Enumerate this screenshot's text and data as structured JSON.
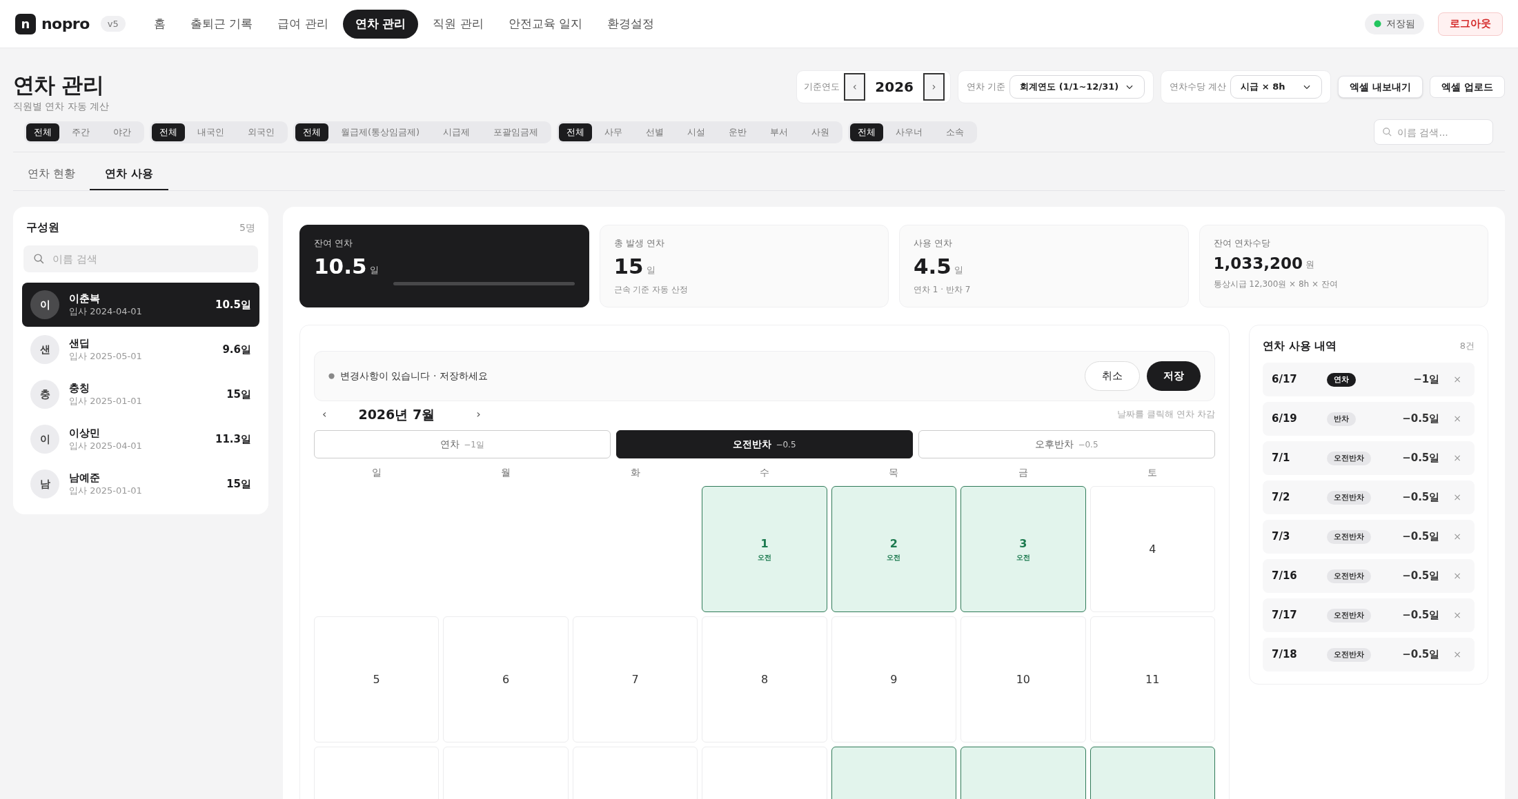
{
  "nav": {
    "logo_letter": "n",
    "brand": "nopro",
    "version": "v5",
    "items": [
      {
        "label": "홈",
        "selected": false
      },
      {
        "label": "출퇴근 기록",
        "selected": false
      },
      {
        "label": "급여 관리",
        "selected": false
      },
      {
        "label": "연차 관리",
        "selected": true
      },
      {
        "label": "직원 관리",
        "selected": false
      },
      {
        "label": "안전교육 일지",
        "selected": false
      },
      {
        "label": "환경설정",
        "selected": false
      }
    ],
    "status": "저장됨",
    "logout": "로그아웃"
  },
  "header": {
    "title": "연차 관리",
    "subtitle": "직원별 연차 자동 계산",
    "year": {
      "label": "기준연도",
      "prev": "‹",
      "value": "2026",
      "next": "›"
    },
    "basis": {
      "label": "연차 기준",
      "value": "회계연도 (1/1~12/31)"
    },
    "allowance": {
      "label": "연차수당 계산",
      "value": "시급 × 8h"
    },
    "buttons": [
      "엑셀 내보내기",
      "엑셀 업로드"
    ]
  },
  "filter_groups": [
    [
      {
        "label": "전체",
        "selected": true
      },
      {
        "label": "주간",
        "selected": false
      },
      {
        "label": "야간",
        "selected": false
      }
    ],
    [
      {
        "label": "전체",
        "selected": true
      },
      {
        "label": "내국인",
        "selected": false
      },
      {
        "label": "외국인",
        "selected": false
      }
    ],
    [
      {
        "label": "전체",
        "selected": true
      },
      {
        "label": "월급제(통상임금제)",
        "selected": false
      },
      {
        "label": "시급제",
        "selected": false
      },
      {
        "label": "포괄임금제",
        "selected": false
      }
    ],
    [
      {
        "label": "전체",
        "selected": true
      },
      {
        "label": "사무",
        "selected": false
      },
      {
        "label": "선별",
        "selected": false
      },
      {
        "label": "시설",
        "selected": false
      },
      {
        "label": "운반",
        "selected": false
      },
      {
        "label": "부서",
        "selected": false
      },
      {
        "label": "사원",
        "selected": false
      }
    ],
    [
      {
        "label": "전체",
        "selected": true
      },
      {
        "label": "사우너",
        "selected": false
      },
      {
        "label": "소속",
        "selected": false
      }
    ]
  ],
  "search": {
    "placeholder": "이름 검색..."
  },
  "tabs": [
    {
      "label": "연차 현황",
      "selected": false
    },
    {
      "label": "연차 사용",
      "selected": true
    }
  ],
  "members": {
    "title": "구성원",
    "count": "5명",
    "search_placeholder": "이름 검색",
    "items": [
      {
        "avatar": "이",
        "name": "이춘복",
        "joined": "입사 2024-04-01",
        "balance": "10.5일",
        "selected": true
      },
      {
        "avatar": "샌",
        "name": "샌딥",
        "joined": "입사 2025-05-01",
        "balance": "9.6일",
        "selected": false
      },
      {
        "avatar": "충",
        "name": "충칭",
        "joined": "입사 2025-01-01",
        "balance": "15일",
        "selected": false
      },
      {
        "avatar": "이",
        "name": "이상민",
        "joined": "입사 2025-04-01",
        "balance": "11.3일",
        "selected": false
      },
      {
        "avatar": "남",
        "name": "남예준",
        "joined": "입사 2025-01-01",
        "balance": "15일",
        "selected": false
      }
    ]
  },
  "stats": [
    {
      "kind": "dark",
      "label": "잔여 연차",
      "value": "10.5",
      "unit": "일",
      "level": 0
    },
    {
      "kind": "plain",
      "label": "총 발생 연차",
      "value": "15",
      "unit": "일",
      "note": "근속 기준 자동 산정"
    },
    {
      "kind": "plain",
      "label": "사용 연차",
      "value": "4.5",
      "unit": "일",
      "note": "연차 1 · 반차 7"
    },
    {
      "kind": "money",
      "label": "잔여 연차수당",
      "value": "1,033,200",
      "unit": "원",
      "note": "통상시급 12,300원 × 8h × 잔여"
    }
  ],
  "calendar": {
    "notice": "변경사항이 있습니다 · 저장하세요",
    "cancel": "취소",
    "save": "저장",
    "prev": "‹",
    "month": "2026년 7월",
    "next": "›",
    "hint": "날짜를 클릭해 연차 차감",
    "modes": [
      {
        "label": "연차",
        "amount": "−1일",
        "selected": false
      },
      {
        "label": "오전반차",
        "amount": "−0.5",
        "selected": true
      },
      {
        "label": "오후반차",
        "amount": "−0.5",
        "selected": false
      }
    ],
    "weekdays": [
      "일",
      "월",
      "화",
      "수",
      "목",
      "금",
      "토"
    ],
    "weeks": [
      [
        {
          "kind": "blank"
        },
        {
          "kind": "blank"
        },
        {
          "kind": "blank"
        },
        {
          "kind": "day",
          "day": "1",
          "tag": "오전",
          "marked": true
        },
        {
          "kind": "day",
          "day": "2",
          "tag": "오전",
          "marked": true
        },
        {
          "kind": "day",
          "day": "3",
          "tag": "오전",
          "marked": true
        },
        {
          "kind": "day",
          "day": "4",
          "marked": false
        }
      ],
      [
        {
          "kind": "day",
          "day": "5",
          "marked": false
        },
        {
          "kind": "day",
          "day": "6",
          "marked": false
        },
        {
          "kind": "day",
          "day": "7",
          "marked": false
        },
        {
          "kind": "day",
          "day": "8",
          "marked": false
        },
        {
          "kind": "day",
          "day": "9",
          "marked": false
        },
        {
          "kind": "day",
          "day": "10",
          "marked": false
        },
        {
          "kind": "day",
          "day": "11",
          "marked": false
        }
      ],
      [
        {
          "kind": "day",
          "marked": false
        },
        {
          "kind": "day",
          "marked": false
        },
        {
          "kind": "day",
          "marked": false
        },
        {
          "kind": "day",
          "marked": false
        },
        {
          "kind": "day",
          "marked": true
        },
        {
          "kind": "day",
          "marked": true
        },
        {
          "kind": "day",
          "marked": true
        }
      ]
    ]
  },
  "history": {
    "title": "연차 사용 내역",
    "count": "8건",
    "entries": [
      {
        "date": "6/17",
        "kind": "full",
        "type": "연차",
        "amount": "−1일",
        "remove": "×"
      },
      {
        "date": "6/19",
        "kind": "half",
        "type": "반차",
        "amount": "−0.5일",
        "remove": "×"
      },
      {
        "date": "7/1",
        "kind": "half",
        "type": "오전반차",
        "amount": "−0.5일",
        "remove": "×"
      },
      {
        "date": "7/2",
        "kind": "half",
        "type": "오전반차",
        "amount": "−0.5일",
        "remove": "×"
      },
      {
        "date": "7/3",
        "kind": "half",
        "type": "오전반차",
        "amount": "−0.5일",
        "remove": "×"
      },
      {
        "date": "7/16",
        "kind": "half",
        "type": "오전반차",
        "amount": "−0.5일",
        "remove": "×"
      },
      {
        "date": "7/17",
        "kind": "half",
        "type": "오전반차",
        "amount": "−0.5일",
        "remove": "×"
      },
      {
        "date": "7/18",
        "kind": "half",
        "type": "오전반차",
        "amount": "−0.5일",
        "remove": "×"
      }
    ]
  }
}
